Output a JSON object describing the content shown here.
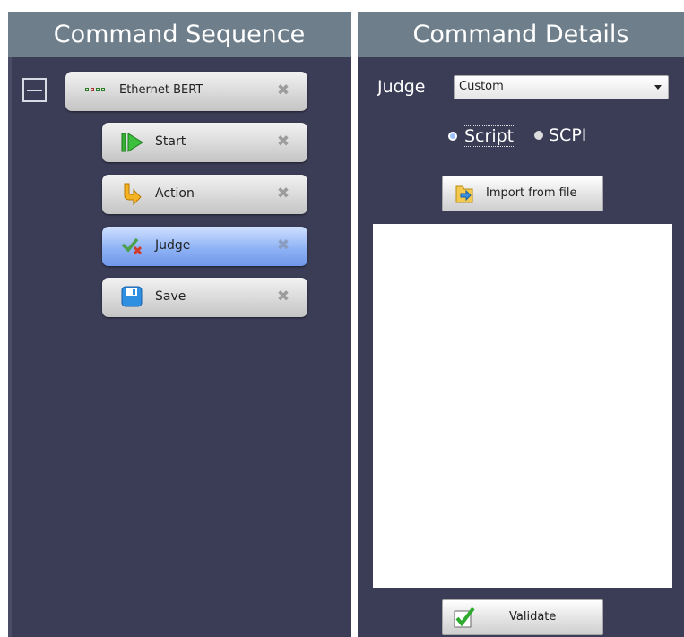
{
  "sequence": {
    "title": "Command Sequence",
    "root": {
      "label": "Ethernet BERT"
    },
    "items": [
      {
        "label": "Start",
        "icon": "play-icon"
      },
      {
        "label": "Action",
        "icon": "arrow-icon"
      },
      {
        "label": "Judge",
        "icon": "check-x-icon",
        "selected": true
      },
      {
        "label": "Save",
        "icon": "floppy-icon"
      }
    ],
    "close_glyph": "✖"
  },
  "details": {
    "title": "Command Details",
    "judge_label": "Judge",
    "judge_value": "Custom",
    "radios": [
      {
        "label": "Script",
        "checked": true
      },
      {
        "label": "SCPI",
        "checked": false
      }
    ],
    "import_label": "Import from file",
    "validate_label": "Validate",
    "script_text": ""
  },
  "colors": {
    "panel": "#3b3d57",
    "header": "#6e7f8b",
    "selected": "#8fb3f5"
  }
}
